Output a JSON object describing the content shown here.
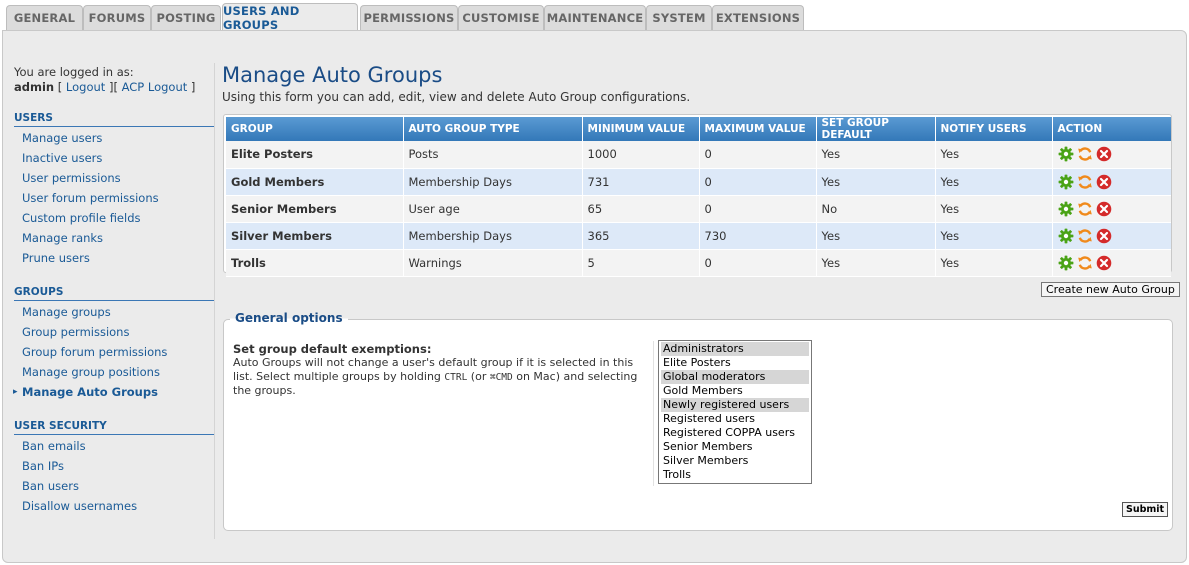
{
  "tabs": [
    {
      "label": "GENERAL"
    },
    {
      "label": "FORUMS"
    },
    {
      "label": "POSTING"
    },
    {
      "label": "USERS AND GROUPS"
    },
    {
      "label": "PERMISSIONS"
    },
    {
      "label": "CUSTOMISE"
    },
    {
      "label": "MAINTENANCE"
    },
    {
      "label": "SYSTEM"
    },
    {
      "label": "EXTENSIONS"
    }
  ],
  "active_tab": "USERS AND GROUPS",
  "login": {
    "prefix": "You are logged in as:",
    "username": "admin",
    "open1": "[ ",
    "logout": "Logout",
    "sep": " ][ ",
    "acp_logout": "ACP Logout",
    "close": " ]"
  },
  "sidebar": {
    "users": {
      "title": "USERS",
      "items": [
        "Manage users",
        "Inactive users",
        "User permissions",
        "User forum permissions",
        "Custom profile fields",
        "Manage ranks",
        "Prune users"
      ]
    },
    "groups": {
      "title": "GROUPS",
      "items": [
        "Manage groups",
        "Group permissions",
        "Group forum permissions",
        "Manage group positions",
        "Manage Auto Groups"
      ]
    },
    "user_security": {
      "title": "USER SECURITY",
      "items": [
        "Ban emails",
        "Ban IPs",
        "Ban users",
        "Disallow usernames"
      ]
    }
  },
  "page": {
    "title": "Manage Auto Groups",
    "description": "Using this form you can add, edit, view and delete Auto Group configurations."
  },
  "table": {
    "headers": [
      "GROUP",
      "AUTO GROUP TYPE",
      "MINIMUM VALUE",
      "MAXIMUM VALUE",
      "SET GROUP DEFAULT",
      "NOTIFY USERS",
      "ACTION"
    ],
    "rows": [
      {
        "group": "Elite Posters",
        "type": "Posts",
        "min": "1000",
        "max": "0",
        "default": "Yes",
        "notify": "Yes"
      },
      {
        "group": "Gold Members",
        "type": "Membership Days",
        "min": "731",
        "max": "0",
        "default": "Yes",
        "notify": "Yes"
      },
      {
        "group": "Senior Members",
        "type": "User age",
        "min": "65",
        "max": "0",
        "default": "No",
        "notify": "Yes"
      },
      {
        "group": "Silver Members",
        "type": "Membership Days",
        "min": "365",
        "max": "730",
        "default": "Yes",
        "notify": "Yes"
      },
      {
        "group": "Trolls",
        "type": "Warnings",
        "min": "5",
        "max": "0",
        "default": "Yes",
        "notify": "Yes"
      }
    ],
    "action_icons": [
      "gear-icon",
      "sync-icon",
      "delete-icon"
    ]
  },
  "create_button": "Create new Auto Group",
  "options": {
    "legend": "General options",
    "label": "Set group default exemptions:",
    "help_1": "Auto Groups will not change a user's default group if it is selected in this list. Select multiple groups by holding ",
    "help_ctrl": "CTRL",
    "help_2": " (or ",
    "help_cmd": "⌘CMD",
    "help_3": " on Mac) and selecting the groups.",
    "groups": [
      {
        "name": "Administrators",
        "selected": true
      },
      {
        "name": "Elite Posters",
        "selected": false
      },
      {
        "name": "Global moderators",
        "selected": true
      },
      {
        "name": "Gold Members",
        "selected": false
      },
      {
        "name": "Newly registered users",
        "selected": true
      },
      {
        "name": "Registered users",
        "selected": false
      },
      {
        "name": "Registered COPPA users",
        "selected": false
      },
      {
        "name": "Senior Members",
        "selected": false
      },
      {
        "name": "Silver Members",
        "selected": false
      },
      {
        "name": "Trolls",
        "selected": false
      }
    ]
  },
  "submit_button": "Submit",
  "colors": {
    "accent": "#1a5a96",
    "header_blue": "#3f85c4",
    "row_alt": "#dde9f8",
    "gear_green": "#4aa316",
    "sync_orange": "#f08a1c",
    "delete_red": "#d42a2a"
  }
}
